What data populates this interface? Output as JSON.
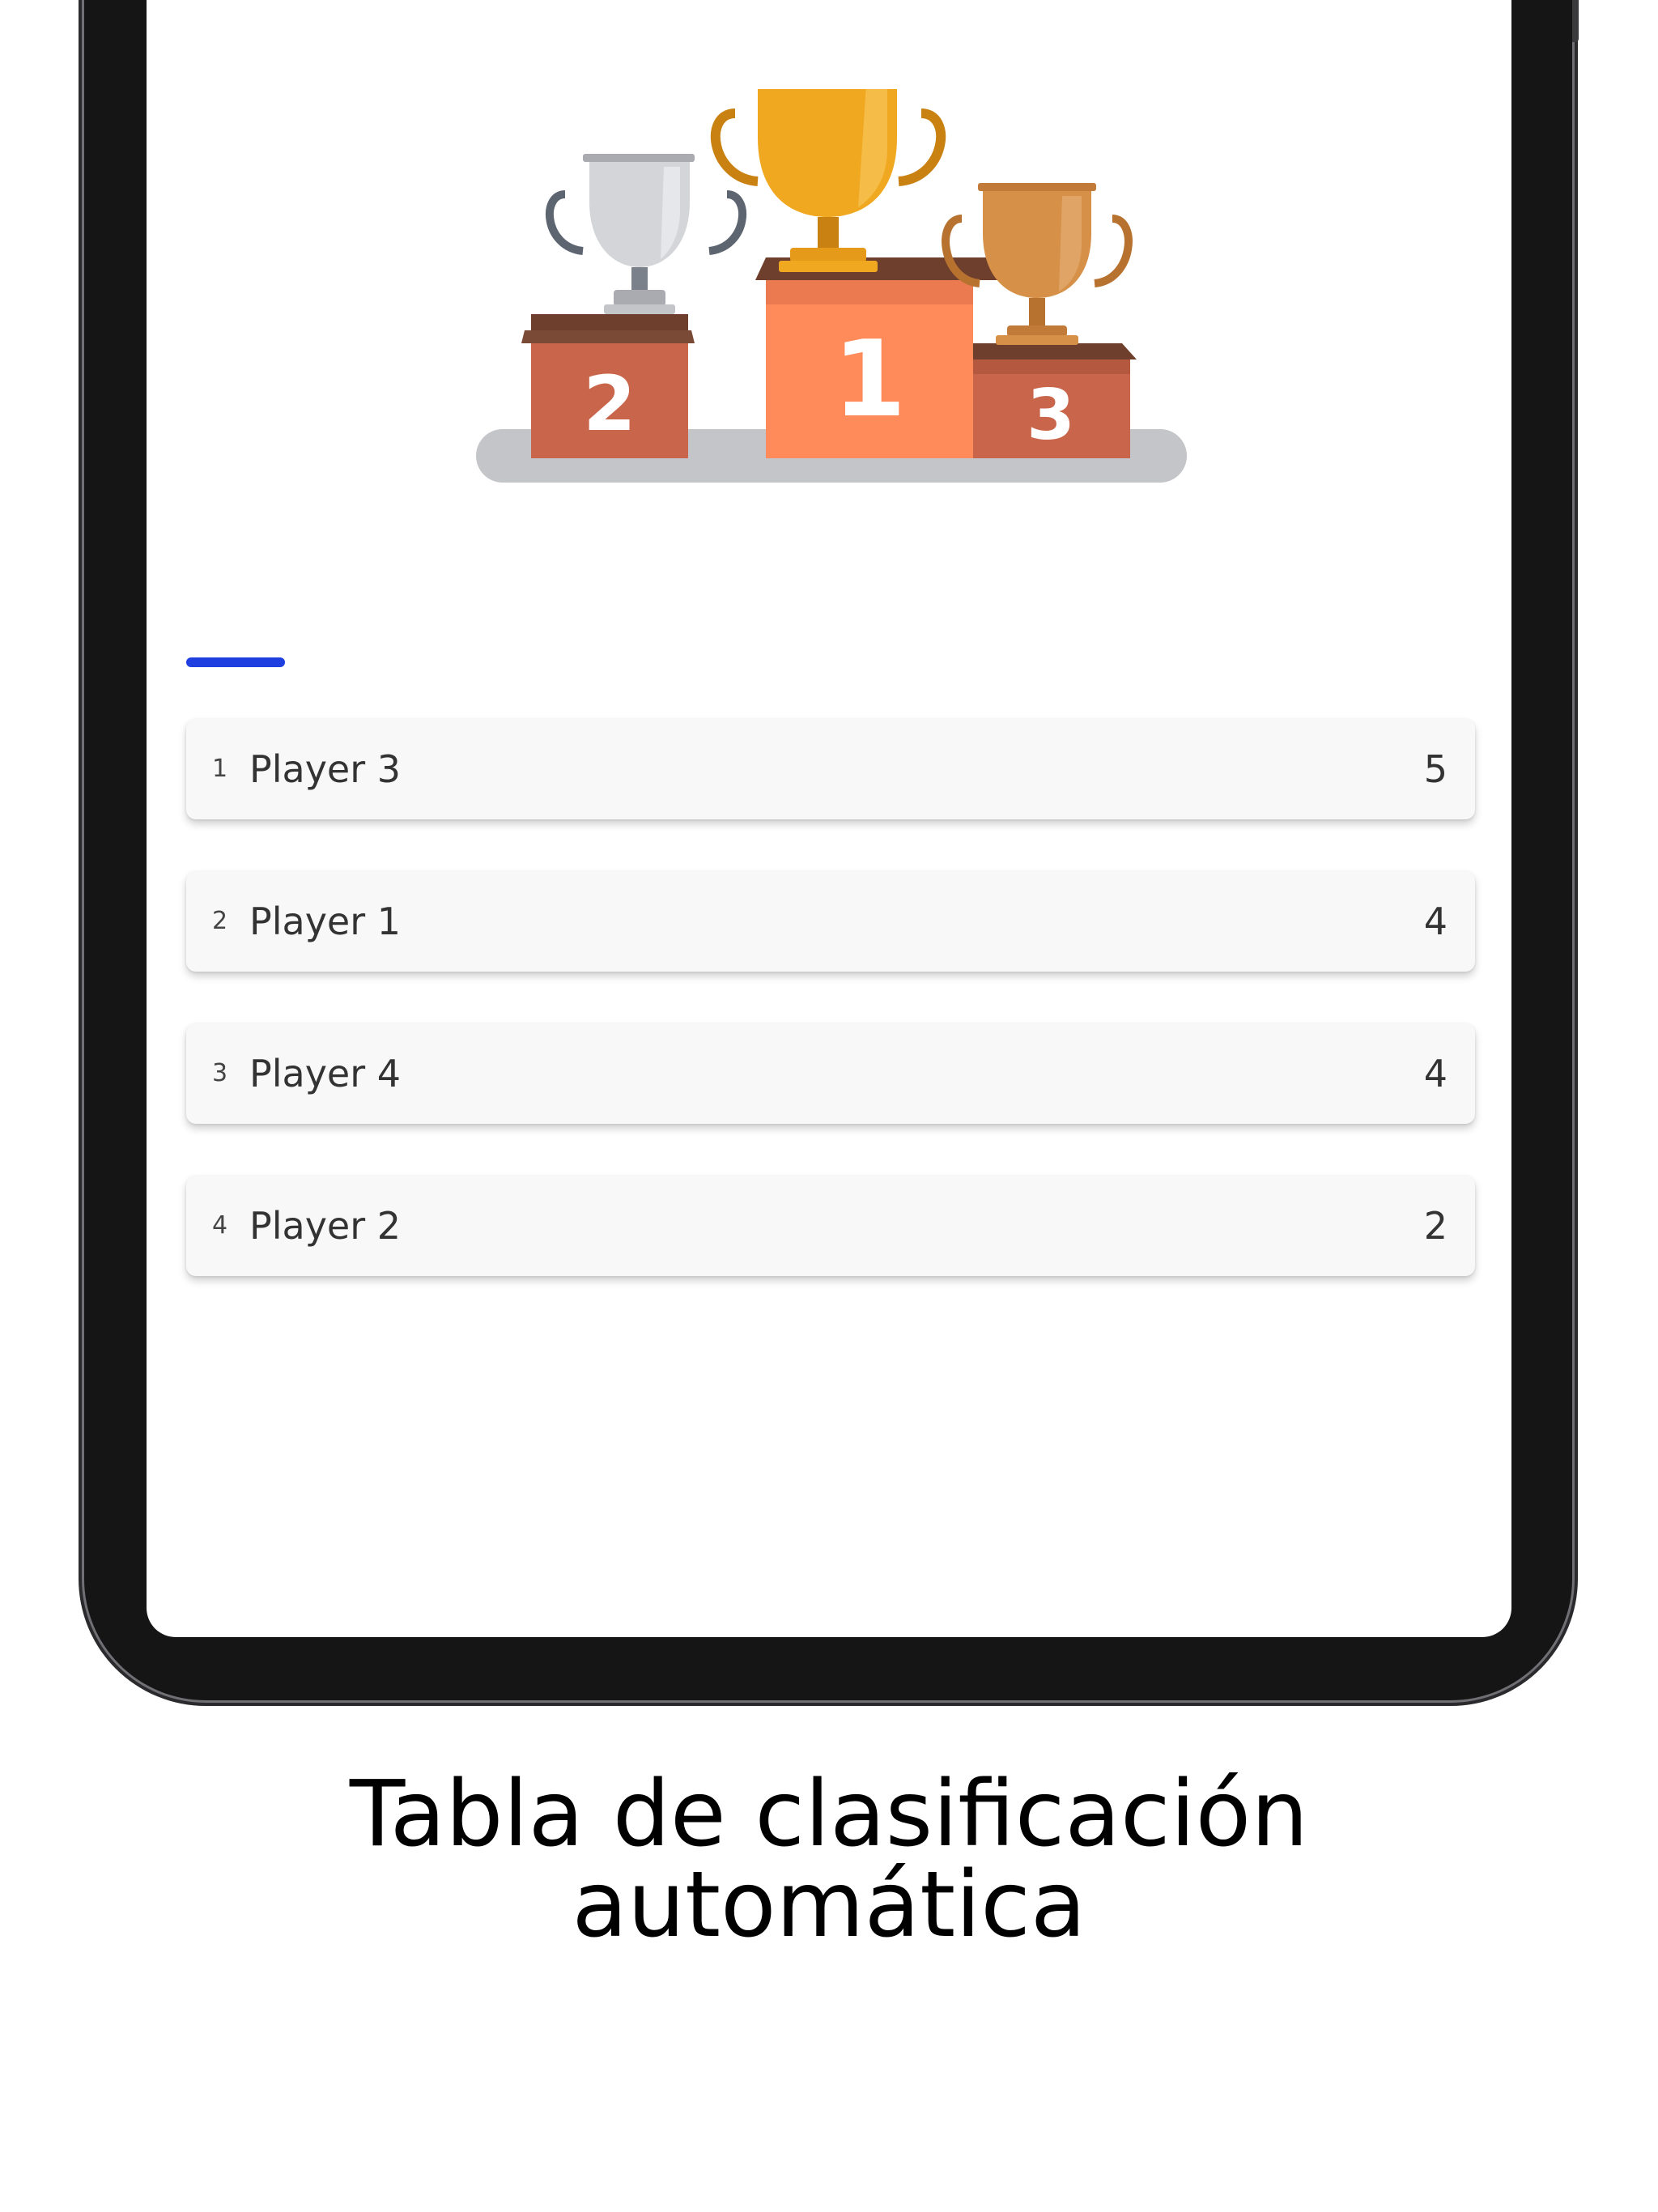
{
  "leaderboard": {
    "rows": [
      {
        "rank": "1",
        "name": "Player 3",
        "score": "5"
      },
      {
        "rank": "2",
        "name": "Player 1",
        "score": "4"
      },
      {
        "rank": "3",
        "name": "Player 4",
        "score": "4"
      },
      {
        "rank": "4",
        "name": "Player 2",
        "score": "2"
      }
    ]
  },
  "podium": {
    "first": "1",
    "second": "2",
    "third": "3"
  },
  "colors": {
    "accent": "#1f3fe0",
    "gold": "#f0a820",
    "silver": "#c8c9cc",
    "bronze": "#d69048",
    "podium_center": "#ff8b5a",
    "podium_side": "#c9654a"
  },
  "caption": {
    "line1": "Tabla de clasificación",
    "line2": "automática"
  }
}
